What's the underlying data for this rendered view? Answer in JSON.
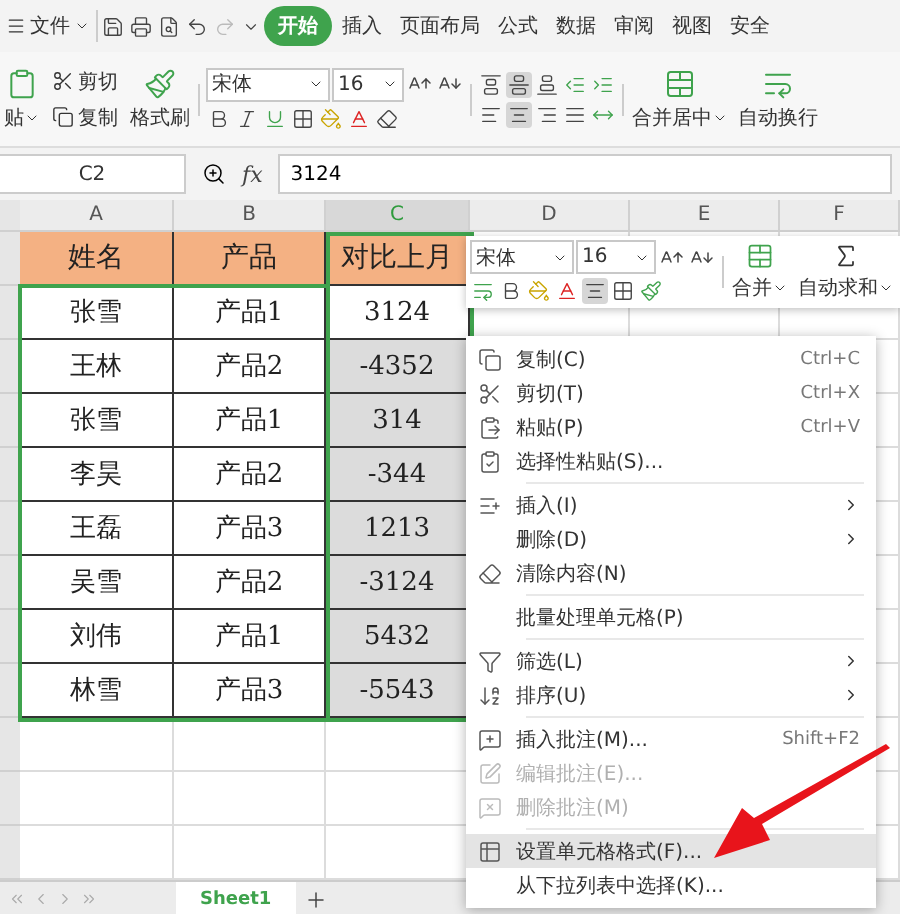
{
  "menu_bar": {
    "file": "文件",
    "tabs": [
      {
        "label": "开始",
        "selected": true
      },
      {
        "label": "插入",
        "selected": false
      },
      {
        "label": "页面布局",
        "selected": false
      },
      {
        "label": "公式",
        "selected": false
      },
      {
        "label": "数据",
        "selected": false
      },
      {
        "label": "审阅",
        "selected": false
      },
      {
        "label": "视图",
        "selected": false
      },
      {
        "label": "安全",
        "selected": false
      }
    ]
  },
  "ribbon": {
    "paste": "贴",
    "cut": "剪切",
    "copy": "复制",
    "format_painter": "格式刷",
    "font": "宋体",
    "size": "16",
    "center_aligned": true,
    "merge": "合并居中",
    "wrap": "自动换行"
  },
  "formula_bar": {
    "cell": "C2",
    "fx_label": "fx",
    "formula": "3124"
  },
  "columns": [
    {
      "label": "A",
      "selected": false
    },
    {
      "label": "B",
      "selected": false
    },
    {
      "label": "C",
      "selected": true
    },
    {
      "label": "D",
      "selected": false
    },
    {
      "label": "E",
      "selected": false
    },
    {
      "label": "F",
      "selected": false
    }
  ],
  "table": {
    "header": [
      "姓名",
      "产品",
      "对比上月"
    ],
    "rows": [
      {
        "cells": [
          "张雪",
          "产品1",
          "3124"
        ],
        "selected": false
      },
      {
        "cells": [
          "王林",
          "产品2",
          "-4352"
        ],
        "selected": true
      },
      {
        "cells": [
          "张雪",
          "产品1",
          "314"
        ],
        "selected": true
      },
      {
        "cells": [
          "李昊",
          "产品2",
          "-344"
        ],
        "selected": true
      },
      {
        "cells": [
          "王磊",
          "产品3",
          "1213"
        ],
        "selected": true
      },
      {
        "cells": [
          "吴雪",
          "产品2",
          "-3124"
        ],
        "selected": true
      },
      {
        "cells": [
          "刘伟",
          "产品1",
          "5432"
        ],
        "selected": true
      },
      {
        "cells": [
          "林雪",
          "产品3",
          "-5543"
        ],
        "selected": true
      }
    ]
  },
  "mini_toolbar": {
    "font": "宋体",
    "size": "16",
    "center_aligned": true,
    "merge": "合并",
    "autosum": "自动求和"
  },
  "context_menu": {
    "items": [
      {
        "kind": "item",
        "label": "复制(C)",
        "shortcut": "Ctrl+C",
        "disabled": false,
        "selected": false,
        "submenu": false
      },
      {
        "kind": "item",
        "label": "剪切(T)",
        "shortcut": "Ctrl+X",
        "disabled": false,
        "selected": false,
        "submenu": false
      },
      {
        "kind": "item",
        "label": "粘贴(P)",
        "shortcut": "Ctrl+V",
        "disabled": false,
        "selected": false,
        "submenu": false
      },
      {
        "kind": "item",
        "label": "选择性粘贴(S)...",
        "disabled": false,
        "selected": false,
        "submenu": false
      },
      {
        "kind": "divider"
      },
      {
        "kind": "item",
        "label": "插入(I)",
        "disabled": false,
        "selected": false,
        "submenu": true
      },
      {
        "kind": "item",
        "label": "删除(D)",
        "disabled": false,
        "selected": false,
        "submenu": true
      },
      {
        "kind": "item",
        "label": "清除内容(N)",
        "disabled": false,
        "selected": false,
        "submenu": false
      },
      {
        "kind": "divider"
      },
      {
        "kind": "item",
        "label": "批量处理单元格(P)",
        "disabled": false,
        "selected": false,
        "submenu": false
      },
      {
        "kind": "divider"
      },
      {
        "kind": "item",
        "label": "筛选(L)",
        "disabled": false,
        "selected": false,
        "submenu": true
      },
      {
        "kind": "item",
        "label": "排序(U)",
        "disabled": false,
        "selected": false,
        "submenu": true
      },
      {
        "kind": "divider"
      },
      {
        "kind": "item",
        "label": "插入批注(M)...",
        "shortcut": "Shift+F2",
        "disabled": false,
        "selected": false,
        "submenu": false
      },
      {
        "kind": "item",
        "label": "编辑批注(E)...",
        "disabled": true,
        "selected": false,
        "submenu": false
      },
      {
        "kind": "item",
        "label": "删除批注(M)",
        "disabled": true,
        "selected": false,
        "submenu": false
      },
      {
        "kind": "divider"
      },
      {
        "kind": "item",
        "label": "设置单元格格式(F)...",
        "disabled": false,
        "selected": true,
        "submenu": false
      },
      {
        "kind": "item",
        "label": "从下拉列表中选择(K)...",
        "disabled": false,
        "selected": false,
        "submenu": false
      }
    ]
  },
  "sheet_tabs": [
    {
      "label": "Sheet1",
      "selected": true
    }
  ]
}
